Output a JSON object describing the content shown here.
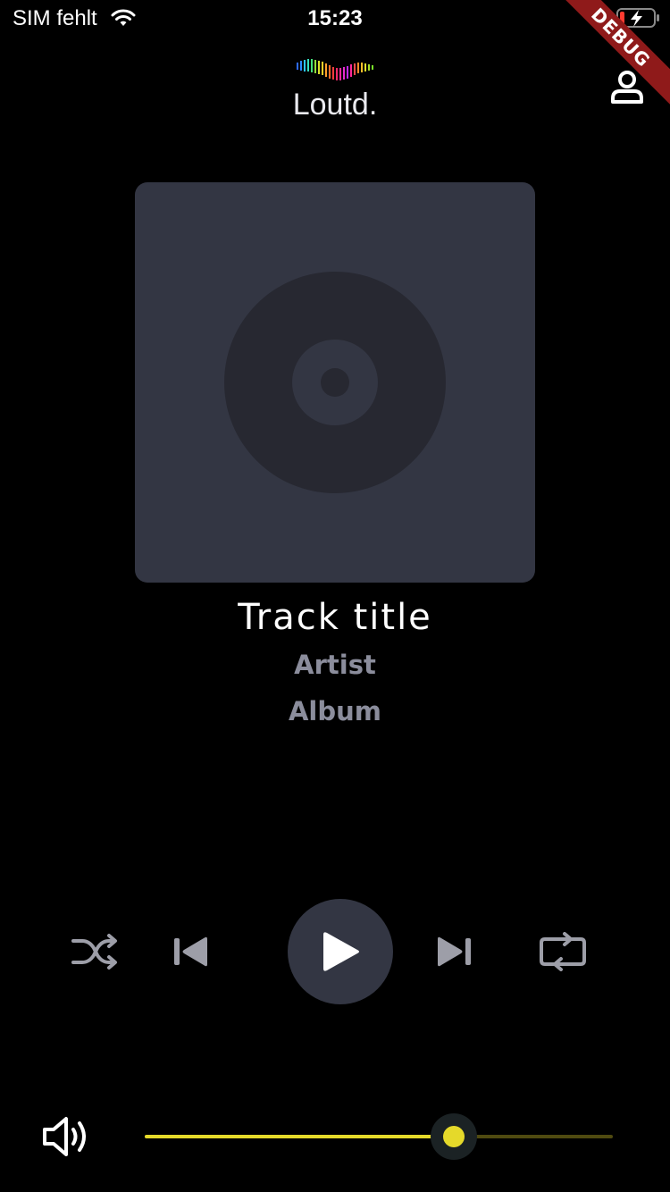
{
  "status_bar": {
    "carrier": "SIM fehlt",
    "time": "15:23",
    "wifi_icon": "wifi-icon",
    "battery_icon": "battery-charging-icon",
    "battery_color": "#ff3b30"
  },
  "debug_banner": {
    "label": "DEBUG",
    "color": "#8f1a1a"
  },
  "header": {
    "logo_text": "Loutd.",
    "profile_icon": "person-icon"
  },
  "player": {
    "artwork_icon": "disc-icon",
    "track_title": "Track title",
    "artist": "Artist",
    "album": "Album",
    "is_playing": false
  },
  "controls": {
    "shuffle_icon": "shuffle-icon",
    "previous_icon": "skip-previous-icon",
    "play_icon": "play-icon",
    "next_icon": "skip-next-icon",
    "repeat_icon": "repeat-icon"
  },
  "volume": {
    "icon": "volume-icon",
    "level": 0.66,
    "accent_color": "#e5d92a"
  },
  "colors": {
    "background": "#000000",
    "surface": "#333643",
    "secondary_text": "#8b8d9c"
  }
}
